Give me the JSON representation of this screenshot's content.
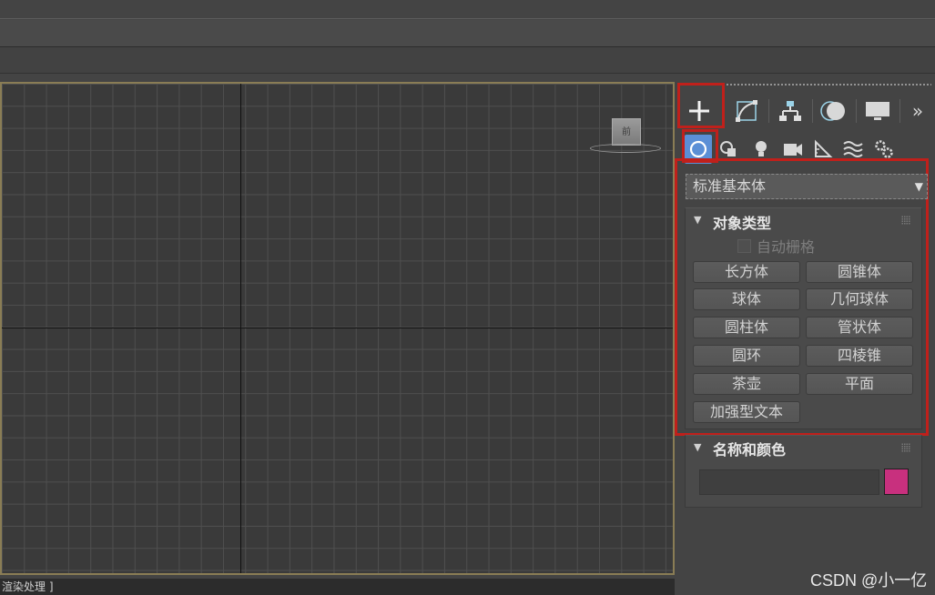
{
  "viewport": {
    "viewcube_label": "前"
  },
  "status_text": "渲染处理 ]",
  "command_panel": {
    "tabs": [
      {
        "name": "create",
        "icon": "plus-icon"
      },
      {
        "name": "modify",
        "icon": "modify-curve-icon"
      },
      {
        "name": "hierarchy",
        "icon": "hierarchy-icon"
      },
      {
        "name": "motion",
        "icon": "motion-icon"
      },
      {
        "name": "display",
        "icon": "monitor-icon"
      },
      {
        "name": "more",
        "label": "»"
      }
    ],
    "categories": [
      "geometry-icon",
      "shapes-icon",
      "lights-icon",
      "cameras-icon",
      "helpers-icon",
      "space-warps-icon",
      "systems-icon"
    ],
    "dropdown_value": "标准基本体",
    "object_type": {
      "title": "对象类型",
      "autogrid_label": "自动栅格",
      "buttons": [
        "长方体",
        "圆锥体",
        "球体",
        "几何球体",
        "圆柱体",
        "管状体",
        "圆环",
        "四棱锥",
        "茶壶",
        "平面",
        "加强型文本"
      ]
    },
    "name_and_color": {
      "title": "名称和颜色",
      "name_value": "",
      "color": "#c8307e"
    }
  },
  "accent_color": "#c0201b",
  "watermark": "CSDN @小一亿"
}
